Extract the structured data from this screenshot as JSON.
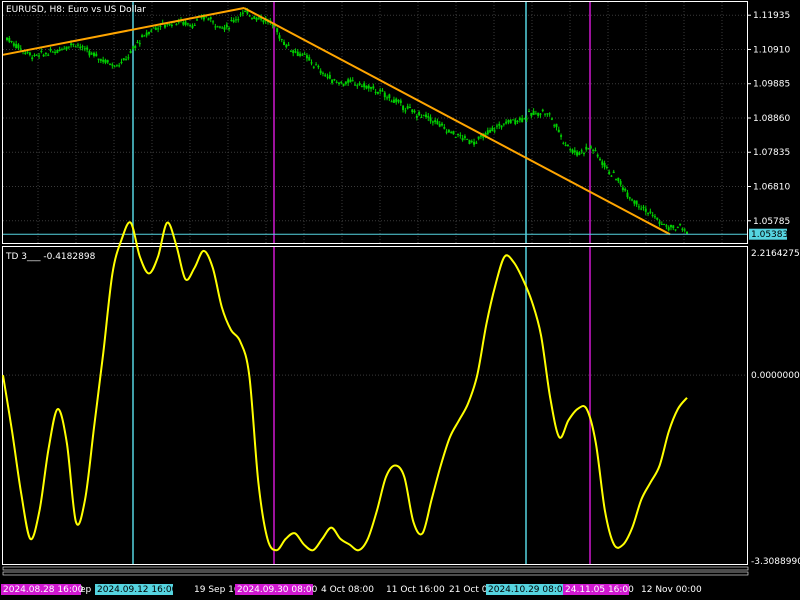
{
  "window": {
    "symbol_label": "EURUSD, H8:  Euro vs US Dollar"
  },
  "indicator": {
    "label": "TD 3___ -0.4182898"
  },
  "colors": {
    "background": "#000000",
    "candles": "#00d000",
    "trendline": "#ffa500",
    "indicator_line": "#ffff00",
    "vline_cyan": "#55d4e0",
    "vline_magenta": "#d018d0",
    "current_price_line": "#55d4e0",
    "grid": "#3a3a3a"
  },
  "price_axis": {
    "ticks": [
      "1.11935",
      "1.10910",
      "1.09885",
      "1.08860",
      "1.07835",
      "1.06810",
      "1.05785"
    ],
    "current_price": "1.05383"
  },
  "indicator_axis": {
    "ticks": [
      "2.2164275",
      "0.0000000",
      "-3.3088990"
    ]
  },
  "time_axis": {
    "labels": [
      "ep",
      "19 Sep 16",
      "4 Oct 08:00",
      "11 Oct 16:00",
      "21 Oct 0",
      "12 Nov 00:00"
    ],
    "highlight_labels": [
      {
        "text": "2024.08.28 16:00",
        "color": "#d018d0"
      },
      {
        "text": "2024.09.12 16:00",
        "color": "#55d4e0"
      },
      {
        "text": "2024.09.30 08:00",
        "color": "#d018d0"
      },
      {
        "text": "2024.10.29 08:00",
        "color": "#55d4e0"
      },
      {
        "text": "24.11.05 16:00",
        "color": "#d018d0"
      }
    ]
  },
  "chart_data": [
    {
      "type": "candlestick",
      "title": "EURUSD, H8:  Euro vs US Dollar",
      "ylim": [
        1.0512,
        1.1233
      ],
      "price_series": [
        1.1125,
        1.111,
        1.1095,
        1.108,
        1.107,
        1.1075,
        1.108,
        1.1085,
        1.1095,
        1.1105,
        1.111,
        1.1095,
        1.108,
        1.107,
        1.106,
        1.105,
        1.1045,
        1.1055,
        1.108,
        1.111,
        1.113,
        1.115,
        1.116,
        1.1165,
        1.117,
        1.1175,
        1.117,
        1.1165,
        1.118,
        1.119,
        1.1175,
        1.116,
        1.1155,
        1.118,
        1.1195,
        1.12,
        1.119,
        1.1185,
        1.1175,
        1.116,
        1.112,
        1.11,
        1.1085,
        1.1075,
        1.106,
        1.104,
        1.102,
        1.1005,
        1.0995,
        1.099,
        1.0993,
        1.0988,
        1.0982,
        1.0975,
        1.0965,
        1.0955,
        1.0945,
        1.093,
        1.0918,
        1.0905,
        1.0895,
        1.089,
        1.088,
        1.0865,
        1.085,
        1.084,
        1.083,
        1.082,
        1.0815,
        1.0825,
        1.084,
        1.0855,
        1.0865,
        1.0875,
        1.088,
        1.0885,
        1.0895,
        1.09,
        1.0905,
        1.0895,
        1.086,
        1.082,
        1.0795,
        1.078,
        1.079,
        1.08,
        1.0775,
        1.0745,
        1.072,
        1.07,
        1.067,
        1.0645,
        1.063,
        1.061,
        1.0595,
        1.0575,
        1.056,
        1.0555,
        1.056,
        1.0545
      ],
      "trendlines": [
        {
          "from": [
            0,
            1.1075
          ],
          "to": [
            30,
            1.1215
          ]
        },
        {
          "from": [
            30,
            1.1215
          ],
          "to": [
            83,
            1.0538
          ]
        }
      ],
      "current_price": 1.05383
    },
    {
      "type": "line",
      "title": "TD 3___ -0.4182898",
      "ylim": [
        -3.308899,
        2.2164275
      ],
      "series": [
        {
          "values": [
            0.0,
            -1.0,
            -2.1,
            -2.9,
            -2.4,
            -1.3,
            -0.6,
            -1.2,
            -2.6,
            -2.2,
            -0.9,
            0.4,
            1.8,
            2.4,
            2.7,
            2.1,
            1.8,
            2.1,
            2.7,
            2.3,
            1.7,
            1.9,
            2.2,
            1.9,
            1.2,
            0.8,
            0.6,
            0.0,
            -1.9,
            -2.9,
            -3.1,
            -2.9,
            -2.8,
            -3.0,
            -3.1,
            -2.9,
            -2.7,
            -2.9,
            -3.0,
            -3.1,
            -2.9,
            -2.4,
            -1.8,
            -1.6,
            -1.8,
            -2.6,
            -2.8,
            -2.2,
            -1.6,
            -1.1,
            -0.8,
            -0.5,
            0.0,
            0.9,
            1.6,
            2.1,
            2.0,
            1.7,
            1.3,
            0.7,
            -0.4,
            -1.1,
            -0.8,
            -0.6,
            -0.6,
            -1.2,
            -2.4,
            -3.0,
            -3.0,
            -2.7,
            -2.2,
            -1.9,
            -1.6,
            -1.0,
            -0.6,
            -0.4
          ]
        }
      ]
    }
  ]
}
